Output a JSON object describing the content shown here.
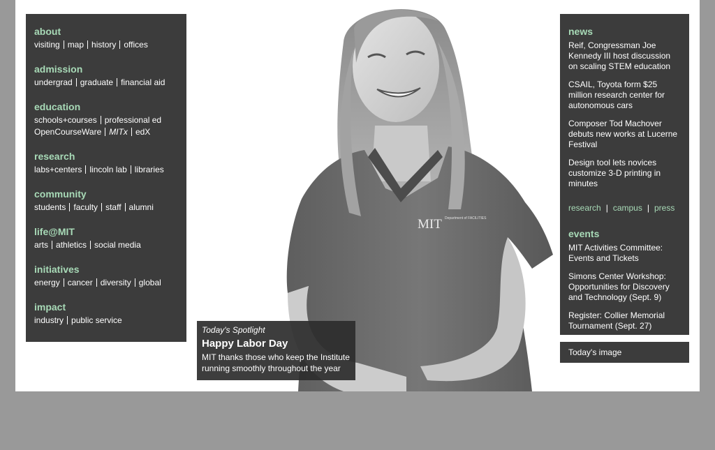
{
  "nav": {
    "sections": [
      {
        "heading": "about",
        "links": [
          "visiting",
          "map",
          "history",
          "offices"
        ]
      },
      {
        "heading": "admission",
        "links": [
          "undergrad",
          "graduate",
          "financial aid"
        ]
      },
      {
        "heading": "education",
        "links": [
          "schools+courses",
          "professional ed",
          "OpenCourseWare",
          "MITx",
          "edX"
        ]
      },
      {
        "heading": "research",
        "links": [
          "labs+centers",
          "lincoln lab",
          "libraries"
        ]
      },
      {
        "heading": "community",
        "links": [
          "students",
          "faculty",
          "staff",
          "alumni"
        ]
      },
      {
        "heading": "life@MIT",
        "links": [
          "arts",
          "athletics",
          "social media"
        ]
      },
      {
        "heading": "initiatives",
        "links": [
          "energy",
          "cancer",
          "diversity",
          "global"
        ]
      },
      {
        "heading": "impact",
        "links": [
          "industry",
          "public service"
        ]
      }
    ]
  },
  "news": {
    "heading": "news",
    "items": [
      "Reif, Congressman Joe Kennedy III host discussion on scaling STEM education",
      "CSAIL, Toyota form $25 million research center for autonomous cars",
      "Composer Tod Machover debuts new works at Lucerne Festival",
      "Design tool lets novices customize 3-D printing in minutes"
    ],
    "categories": [
      "research",
      "campus",
      "press"
    ]
  },
  "events": {
    "heading": "events",
    "items": [
      "MIT Activities Committee: Events and Tickets",
      "Simons Center Workshop: Opportunities for Discovery and Technology (Sept. 9)",
      "Register: Collier Memorial Tournament (Sept. 27)"
    ]
  },
  "today_image": {
    "label": "Today's image"
  },
  "spotlight": {
    "kicker": "Today's Spotlight",
    "title": "Happy Labor Day",
    "description": "MIT thanks those who keep the Institute running smoothly throughout the year"
  },
  "hero": {
    "shirt_text": "MIT",
    "shirt_subtext": "Department of FACILITIES"
  },
  "colors": {
    "accent": "#a8dab7",
    "panel": "#3c3c3c",
    "frame": "#999999"
  }
}
